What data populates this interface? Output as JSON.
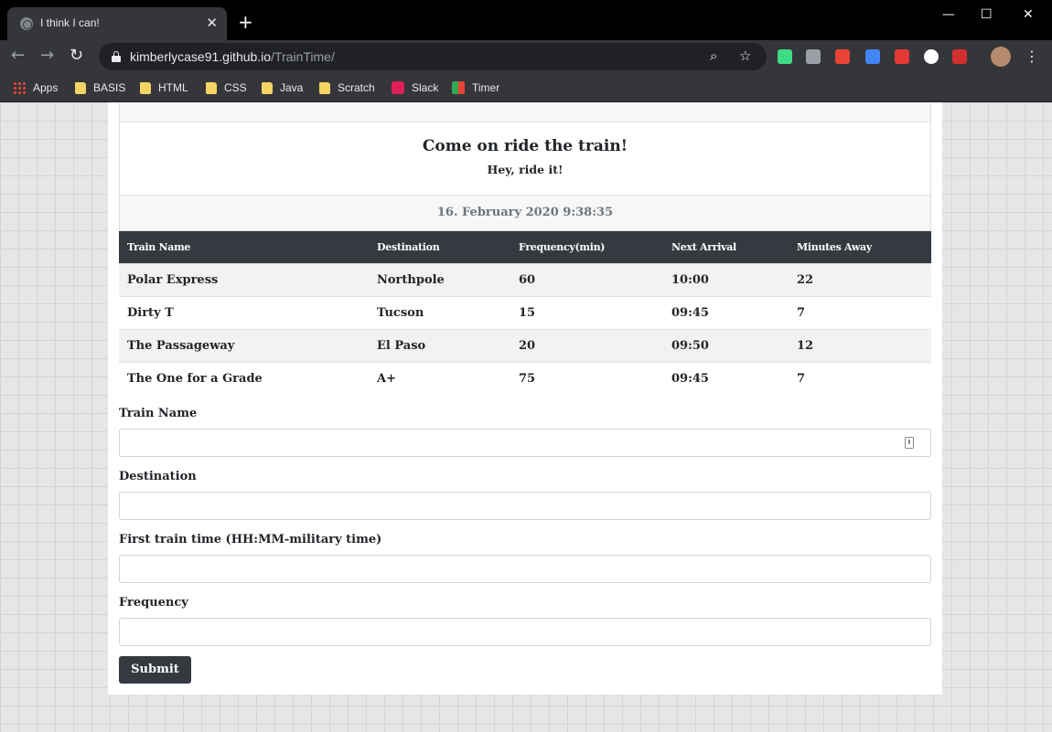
{
  "browser": {
    "tab_title": "I think I can!",
    "tab_close": "✕",
    "new_tab": "+",
    "window_controls": {
      "minimize": "—",
      "maximize": "☐",
      "close": "✕"
    },
    "nav": {
      "back": "←",
      "forward": "→",
      "reload": "↻"
    },
    "url_host": "kimberlycase91.github.io",
    "url_path": "/TrainTime/",
    "zoom_icon": "⌕",
    "star_icon": "☆",
    "menu_icon": "⋮",
    "bookmarks": [
      "Apps",
      "BASIS",
      "HTML",
      "CSS",
      "Java",
      "Scratch",
      "Slack",
      "Timer"
    ]
  },
  "page": {
    "heading": "Come on ride the train!",
    "subheading": "Hey, ride it!",
    "current_time": "16. February 2020 9:38:35",
    "table": {
      "headers": [
        "Train Name",
        "Destination",
        "Frequency(min)",
        "Next Arrival",
        "Minutes Away"
      ],
      "rows": [
        [
          "Polar Express",
          "Northpole",
          "60",
          "10:00",
          "22"
        ],
        [
          "Dirty T",
          "Tucson",
          "15",
          "09:45",
          "7"
        ],
        [
          "The Passageway",
          "El Paso",
          "20",
          "09:50",
          "12"
        ],
        [
          "The One for a Grade",
          "A+",
          "75",
          "09:45",
          "7"
        ]
      ]
    },
    "form": {
      "train_name_label": "Train Name",
      "destination_label": "Destination",
      "first_time_label": "First train time (HH:MM-military time)",
      "frequency_label": "Frequency",
      "submit_label": "Submit"
    }
  }
}
